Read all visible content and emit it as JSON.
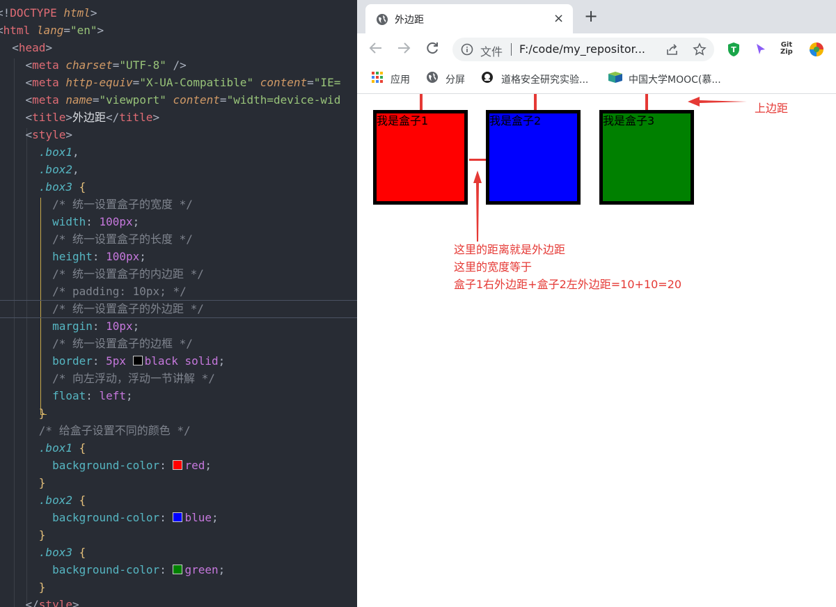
{
  "editor": {
    "lines": [
      {
        "parts": [
          {
            "c": "p",
            "v": "<!"
          },
          {
            "c": "t",
            "v": "DOCTYPE "
          },
          {
            "c": "a",
            "v": "html"
          },
          {
            "c": "p",
            "v": ">"
          }
        ]
      },
      {
        "parts": [
          {
            "c": "p",
            "v": "<"
          },
          {
            "c": "t",
            "v": "html "
          },
          {
            "c": "a",
            "v": "lang"
          },
          {
            "c": "p",
            "v": "="
          },
          {
            "c": "s",
            "v": "\"en\""
          },
          {
            "c": "p",
            "v": ">"
          }
        ]
      },
      {
        "parts": [
          {
            "c": "p",
            "v": "  <"
          },
          {
            "c": "t",
            "v": "head"
          },
          {
            "c": "p",
            "v": ">"
          }
        ]
      },
      {
        "parts": [
          {
            "c": "p",
            "v": "    <"
          },
          {
            "c": "t",
            "v": "meta "
          },
          {
            "c": "a",
            "v": "charset"
          },
          {
            "c": "p",
            "v": "="
          },
          {
            "c": "s",
            "v": "\"UTF-8\""
          },
          {
            "c": "p",
            "v": " />"
          }
        ]
      },
      {
        "parts": [
          {
            "c": "p",
            "v": "    <"
          },
          {
            "c": "t",
            "v": "meta "
          },
          {
            "c": "a",
            "v": "http-equiv"
          },
          {
            "c": "p",
            "v": "="
          },
          {
            "c": "s",
            "v": "\"X-UA-Compatible\""
          },
          {
            "c": "p",
            "v": " "
          },
          {
            "c": "a",
            "v": "content"
          },
          {
            "c": "p",
            "v": "="
          },
          {
            "c": "s",
            "v": "\"IE="
          }
        ]
      },
      {
        "parts": [
          {
            "c": "p",
            "v": "    <"
          },
          {
            "c": "t",
            "v": "meta "
          },
          {
            "c": "a",
            "v": "name"
          },
          {
            "c": "p",
            "v": "="
          },
          {
            "c": "s",
            "v": "\"viewport\""
          },
          {
            "c": "p",
            "v": " "
          },
          {
            "c": "a",
            "v": "content"
          },
          {
            "c": "p",
            "v": "="
          },
          {
            "c": "s",
            "v": "\"width=device-wid"
          }
        ]
      },
      {
        "parts": [
          {
            "c": "p",
            "v": "    <"
          },
          {
            "c": "t",
            "v": "title"
          },
          {
            "c": "p",
            "v": ">"
          },
          {
            "c": "wt",
            "v": "外边距"
          },
          {
            "c": "p",
            "v": "</"
          },
          {
            "c": "t",
            "v": "title"
          },
          {
            "c": "p",
            "v": ">"
          }
        ]
      },
      {
        "parts": [
          {
            "c": "p",
            "v": "    <"
          },
          {
            "c": "t",
            "v": "style"
          },
          {
            "c": "p",
            "v": ">"
          }
        ]
      },
      {
        "parts": [
          {
            "c": "p",
            "v": "      "
          },
          {
            "c": "sel",
            "v": ".box1"
          },
          {
            "c": "p",
            "v": ","
          }
        ]
      },
      {
        "parts": [
          {
            "c": "p",
            "v": "      "
          },
          {
            "c": "sel",
            "v": ".box2"
          },
          {
            "c": "p",
            "v": ","
          }
        ]
      },
      {
        "parts": [
          {
            "c": "p",
            "v": "      "
          },
          {
            "c": "sel",
            "v": ".box3"
          },
          {
            "c": "p",
            "v": " "
          },
          {
            "c": "br",
            "v": "{"
          }
        ]
      },
      {
        "parts": [
          {
            "c": "p",
            "v": "        "
          },
          {
            "c": "cm",
            "v": "/* 统一设置盒子的宽度 */"
          }
        ]
      },
      {
        "parts": [
          {
            "c": "p",
            "v": "        "
          },
          {
            "c": "prop",
            "v": "width"
          },
          {
            "c": "p",
            "v": ": "
          },
          {
            "c": "num",
            "v": "100px"
          },
          {
            "c": "p",
            "v": ";"
          }
        ]
      },
      {
        "parts": [
          {
            "c": "p",
            "v": "        "
          },
          {
            "c": "cm",
            "v": "/* 统一设置盒子的长度 */"
          }
        ]
      },
      {
        "parts": [
          {
            "c": "p",
            "v": "        "
          },
          {
            "c": "prop",
            "v": "height"
          },
          {
            "c": "p",
            "v": ": "
          },
          {
            "c": "num",
            "v": "100px"
          },
          {
            "c": "p",
            "v": ";"
          }
        ]
      },
      {
        "parts": [
          {
            "c": "p",
            "v": "        "
          },
          {
            "c": "cm",
            "v": "/* 统一设置盒子的内边距 */"
          }
        ]
      },
      {
        "parts": [
          {
            "c": "p",
            "v": "        "
          },
          {
            "c": "cm",
            "v": "/* padding: 10px; */"
          }
        ]
      },
      {
        "parts": [
          {
            "c": "p",
            "v": "        "
          },
          {
            "c": "cm",
            "v": "/* 统一设置盒子的外边距 */"
          }
        ]
      },
      {
        "parts": [
          {
            "c": "p",
            "v": "        "
          },
          {
            "c": "prop",
            "v": "margin"
          },
          {
            "c": "p",
            "v": ": "
          },
          {
            "c": "num",
            "v": "10px"
          },
          {
            "c": "p",
            "v": ";"
          }
        ]
      },
      {
        "parts": [
          {
            "c": "p",
            "v": "        "
          },
          {
            "c": "cm",
            "v": "/* 统一设置盒子的边框 */"
          }
        ]
      },
      {
        "parts": [
          {
            "c": "p",
            "v": "        "
          },
          {
            "c": "prop",
            "v": "border"
          },
          {
            "c": "p",
            "v": ": "
          },
          {
            "c": "num",
            "v": "5px "
          },
          {
            "c": "sw",
            "v": "#000000"
          },
          {
            "c": "kw",
            "v": "black solid"
          },
          {
            "c": "p",
            "v": ";"
          }
        ]
      },
      {
        "parts": [
          {
            "c": "p",
            "v": "        "
          },
          {
            "c": "cm",
            "v": "/* 向左浮动，浮动一节讲解 */"
          }
        ]
      },
      {
        "parts": [
          {
            "c": "p",
            "v": "        "
          },
          {
            "c": "prop",
            "v": "float"
          },
          {
            "c": "p",
            "v": ": "
          },
          {
            "c": "kw",
            "v": "left"
          },
          {
            "c": "p",
            "v": ";"
          }
        ]
      },
      {
        "parts": [
          {
            "c": "p",
            "v": "      "
          },
          {
            "c": "br",
            "v": "}"
          }
        ]
      },
      {
        "parts": [
          {
            "c": "p",
            "v": "      "
          },
          {
            "c": "cm",
            "v": "/* 给盒子设置不同的颜色 */"
          }
        ]
      },
      {
        "parts": [
          {
            "c": "p",
            "v": "      "
          },
          {
            "c": "sel",
            "v": ".box1"
          },
          {
            "c": "p",
            "v": " "
          },
          {
            "c": "br",
            "v": "{"
          }
        ]
      },
      {
        "parts": [
          {
            "c": "p",
            "v": "        "
          },
          {
            "c": "prop",
            "v": "background-color"
          },
          {
            "c": "p",
            "v": ": "
          },
          {
            "c": "sw",
            "v": "#ff0000"
          },
          {
            "c": "kw",
            "v": "red"
          },
          {
            "c": "p",
            "v": ";"
          }
        ]
      },
      {
        "parts": [
          {
            "c": "p",
            "v": "      "
          },
          {
            "c": "br",
            "v": "}"
          }
        ]
      },
      {
        "parts": [
          {
            "c": "p",
            "v": "      "
          },
          {
            "c": "sel",
            "v": ".box2"
          },
          {
            "c": "p",
            "v": " "
          },
          {
            "c": "br",
            "v": "{"
          }
        ]
      },
      {
        "parts": [
          {
            "c": "p",
            "v": "        "
          },
          {
            "c": "prop",
            "v": "background-color"
          },
          {
            "c": "p",
            "v": ": "
          },
          {
            "c": "sw",
            "v": "#0000ff"
          },
          {
            "c": "kw",
            "v": "blue"
          },
          {
            "c": "p",
            "v": ";"
          }
        ]
      },
      {
        "parts": [
          {
            "c": "p",
            "v": "      "
          },
          {
            "c": "br",
            "v": "}"
          }
        ]
      },
      {
        "parts": [
          {
            "c": "p",
            "v": "      "
          },
          {
            "c": "sel",
            "v": ".box3"
          },
          {
            "c": "p",
            "v": " "
          },
          {
            "c": "br",
            "v": "{"
          }
        ]
      },
      {
        "parts": [
          {
            "c": "p",
            "v": "        "
          },
          {
            "c": "prop",
            "v": "background-color"
          },
          {
            "c": "p",
            "v": ": "
          },
          {
            "c": "sw",
            "v": "#008000"
          },
          {
            "c": "kw",
            "v": "green"
          },
          {
            "c": "p",
            "v": ";"
          }
        ]
      },
      {
        "parts": [
          {
            "c": "p",
            "v": "      "
          },
          {
            "c": "br",
            "v": "}"
          }
        ]
      },
      {
        "parts": [
          {
            "c": "p",
            "v": "    </"
          },
          {
            "c": "t",
            "v": "style"
          },
          {
            "c": "p",
            "v": ">"
          }
        ]
      }
    ]
  },
  "browser": {
    "tab": {
      "title": "外边距",
      "close": "×",
      "new_tab": "+"
    },
    "toolbar": {
      "scheme": "文件",
      "url": "F:/code/my_repositor..."
    },
    "bookmarks": [
      {
        "label": "应用",
        "icon": "apps-grid-icon"
      },
      {
        "label": "分屏",
        "icon": "globe-icon"
      },
      {
        "label": "道格安全研究实验...",
        "icon": "doug-lab-icon"
      },
      {
        "label": "中国大学MOOC(慕...",
        "icon": "mooc-icon"
      }
    ],
    "page": {
      "boxes": [
        {
          "label": "我是盒子1",
          "color": "#ff0000"
        },
        {
          "label": "我是盒子2",
          "color": "#0000ff"
        },
        {
          "label": "我是盒子3",
          "color": "#008000"
        }
      ],
      "annotations": {
        "top_margin_label": "上边距",
        "gap_line1": "这里的距离就是外边距",
        "gap_line2": "这里的宽度等于",
        "gap_line3": "盒子1右外边距+盒子2左外边距=10+10=20"
      },
      "annotation_color": "#e53935"
    }
  }
}
